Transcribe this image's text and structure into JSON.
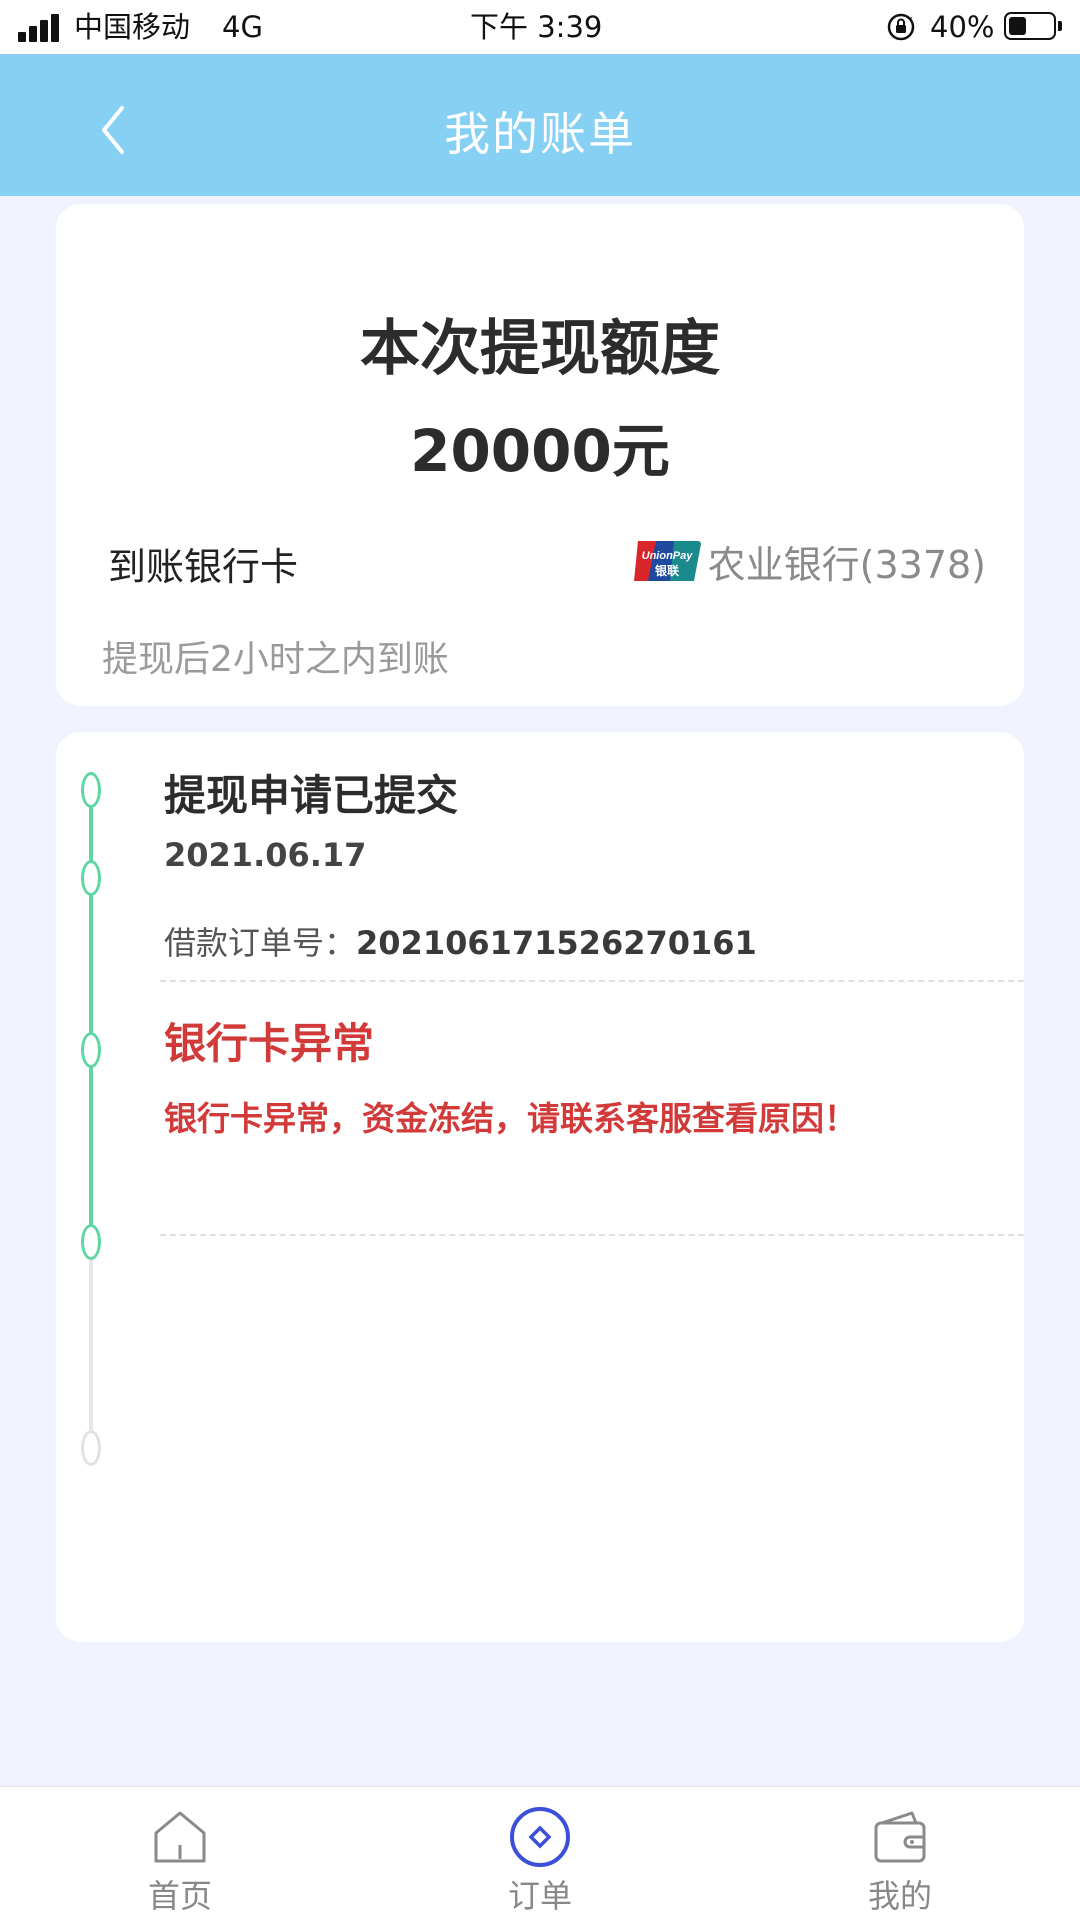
{
  "status_bar": {
    "carrier": "中国移动",
    "network": "4G",
    "time": "下午 3:39",
    "battery_percent": "40%",
    "battery_level": 0.4
  },
  "header": {
    "title": "我的账单",
    "back_icon": "chevron-left-icon"
  },
  "withdrawal": {
    "amount_label": "本次提现额度",
    "amount_value": "20000元",
    "bank_label": "到账银行卡",
    "bank_logo": "unionpay-logo",
    "bank_logo_text_top": "UnionPay",
    "bank_logo_text_bottom": "银联",
    "bank_name": "农业银行(3378)",
    "arrival_note": "提现后2小时之内到账"
  },
  "timeline": {
    "step1": {
      "title": "提现申请已提交",
      "date": "2021.06.17",
      "order_label": "借款订单号：",
      "order_number": "20210617152627016​1"
    },
    "step2": {
      "title": "银行卡异常",
      "message": "银行卡异常，资金冻结，请联系客服查看原因！"
    },
    "colors": {
      "active": "#5fd6a3",
      "inactive": "#e2e2e2",
      "error": "#d23a3a"
    }
  },
  "tabbar": {
    "items": [
      {
        "label": "首页",
        "icon": "home-icon"
      },
      {
        "label": "订单",
        "icon": "order-icon"
      },
      {
        "label": "我的",
        "icon": "wallet-icon"
      }
    ]
  },
  "colors": {
    "header_bg": "#86d0f3",
    "page_bg": "#f0f3ff"
  }
}
